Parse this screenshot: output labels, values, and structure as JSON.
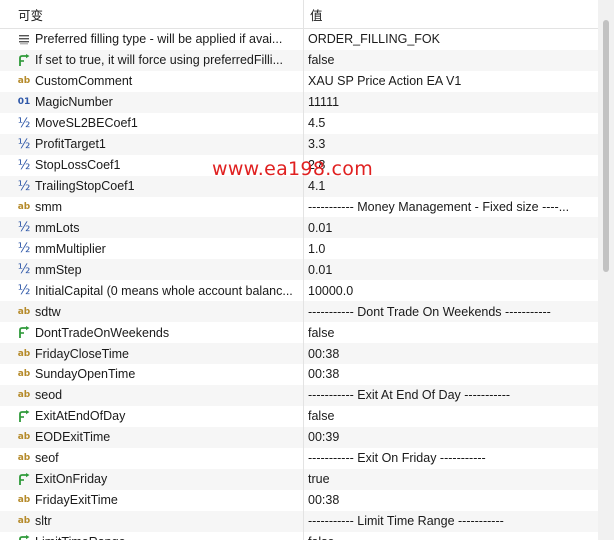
{
  "header": {
    "name_label": "可变",
    "value_label": "值"
  },
  "watermark": "www.ea198.com",
  "rows": [
    {
      "icon": "enum",
      "name": "Preferred filling type - will be applied if avai...",
      "value": "ORDER_FILLING_FOK"
    },
    {
      "icon": "bool",
      "name": "If set to true, it will force using preferredFilli...",
      "value": "false"
    },
    {
      "icon": "string",
      "name": "CustomComment",
      "value": "XAU SP Price Action EA V1"
    },
    {
      "icon": "int",
      "name": "MagicNumber",
      "value": "11111"
    },
    {
      "icon": "double",
      "name": "MoveSL2BECoef1",
      "value": "4.5"
    },
    {
      "icon": "double",
      "name": "ProfitTarget1",
      "value": "3.3"
    },
    {
      "icon": "double",
      "name": "StopLossCoef1",
      "value": "2.8"
    },
    {
      "icon": "double",
      "name": "TrailingStopCoef1",
      "value": "4.1"
    },
    {
      "icon": "string",
      "name": "smm",
      "value": "----------- Money Management - Fixed size ----..."
    },
    {
      "icon": "double",
      "name": "mmLots",
      "value": "0.01"
    },
    {
      "icon": "double",
      "name": "mmMultiplier",
      "value": "1.0"
    },
    {
      "icon": "double",
      "name": "mmStep",
      "value": "0.01"
    },
    {
      "icon": "double",
      "name": "InitialCapital (0 means whole account balanc...",
      "value": "10000.0"
    },
    {
      "icon": "string",
      "name": "sdtw",
      "value": "----------- Dont Trade On Weekends -----------"
    },
    {
      "icon": "bool",
      "name": "DontTradeOnWeekends",
      "value": "false"
    },
    {
      "icon": "string",
      "name": "FridayCloseTime",
      "value": "00:38"
    },
    {
      "icon": "string",
      "name": "SundayOpenTime",
      "value": "00:38"
    },
    {
      "icon": "string",
      "name": "seod",
      "value": "----------- Exit At End Of Day -----------"
    },
    {
      "icon": "bool",
      "name": "ExitAtEndOfDay",
      "value": "false"
    },
    {
      "icon": "string",
      "name": "EODExitTime",
      "value": "00:39"
    },
    {
      "icon": "string",
      "name": "seof",
      "value": "----------- Exit On Friday -----------"
    },
    {
      "icon": "bool",
      "name": "ExitOnFriday",
      "value": "true"
    },
    {
      "icon": "string",
      "name": "FridayExitTime",
      "value": "00:38"
    },
    {
      "icon": "string",
      "name": "sltr",
      "value": "----------- Limit Time Range -----------"
    },
    {
      "icon": "bool",
      "name": "LimitTimeRange",
      "value": "false"
    }
  ]
}
